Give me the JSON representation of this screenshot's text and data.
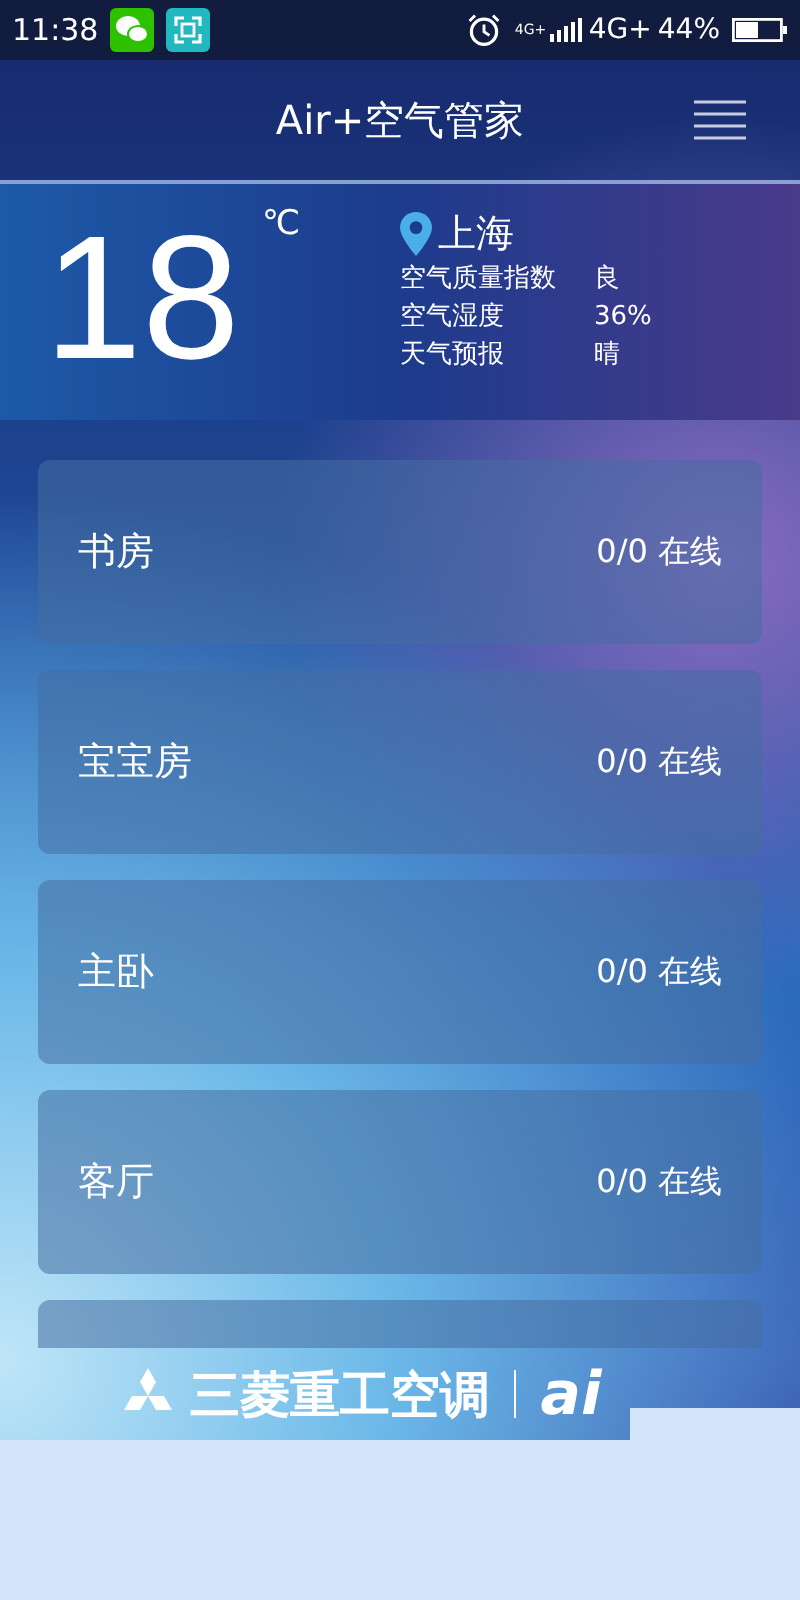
{
  "status_bar": {
    "time": "11:38",
    "network_small": "4G+",
    "network": "4G+",
    "battery": "44%"
  },
  "header": {
    "title": "Air+空气管家"
  },
  "weather": {
    "temperature": "18",
    "unit": "℃",
    "city": "上海",
    "rows": [
      {
        "label": "空气质量指数",
        "value": "良"
      },
      {
        "label": "空气湿度",
        "value": "36%"
      },
      {
        "label": "天气预报",
        "value": "晴"
      }
    ]
  },
  "rooms": [
    {
      "kind": "room",
      "name": "书房",
      "status": "0/0 在线"
    },
    {
      "kind": "room",
      "name": "宝宝房",
      "status": "0/0 在线"
    },
    {
      "kind": "room",
      "name": "主卧",
      "status": "0/0 在线"
    },
    {
      "kind": "room",
      "name": "客厅",
      "status": "0/0 在线"
    },
    {
      "kind": "partial"
    }
  ],
  "footer": {
    "brand": "三菱重工空调",
    "logo": "ai"
  }
}
